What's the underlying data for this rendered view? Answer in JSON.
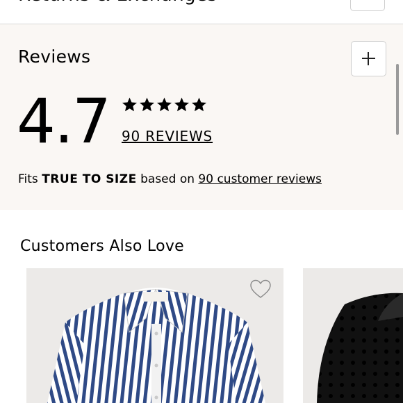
{
  "top_section": {
    "title": "Returns & Exchanges"
  },
  "reviews": {
    "title": "Reviews",
    "rating": "4.7",
    "stars_filled": 5,
    "reviews_link": "90 REVIEWS",
    "fit_prefix": "Fits ",
    "fit_bold": "TRUE TO SIZE",
    "fit_middle": " based on ",
    "fit_link": "90 customer reviews"
  },
  "also_love": {
    "title": "Customers Also Love"
  },
  "colors": {
    "section_bg": "#faf7f4",
    "card_bg": "#eceae8",
    "stripe_blue": "#2f4a86"
  },
  "icons": [
    "plus-icon",
    "star-icon",
    "heart-icon"
  ]
}
